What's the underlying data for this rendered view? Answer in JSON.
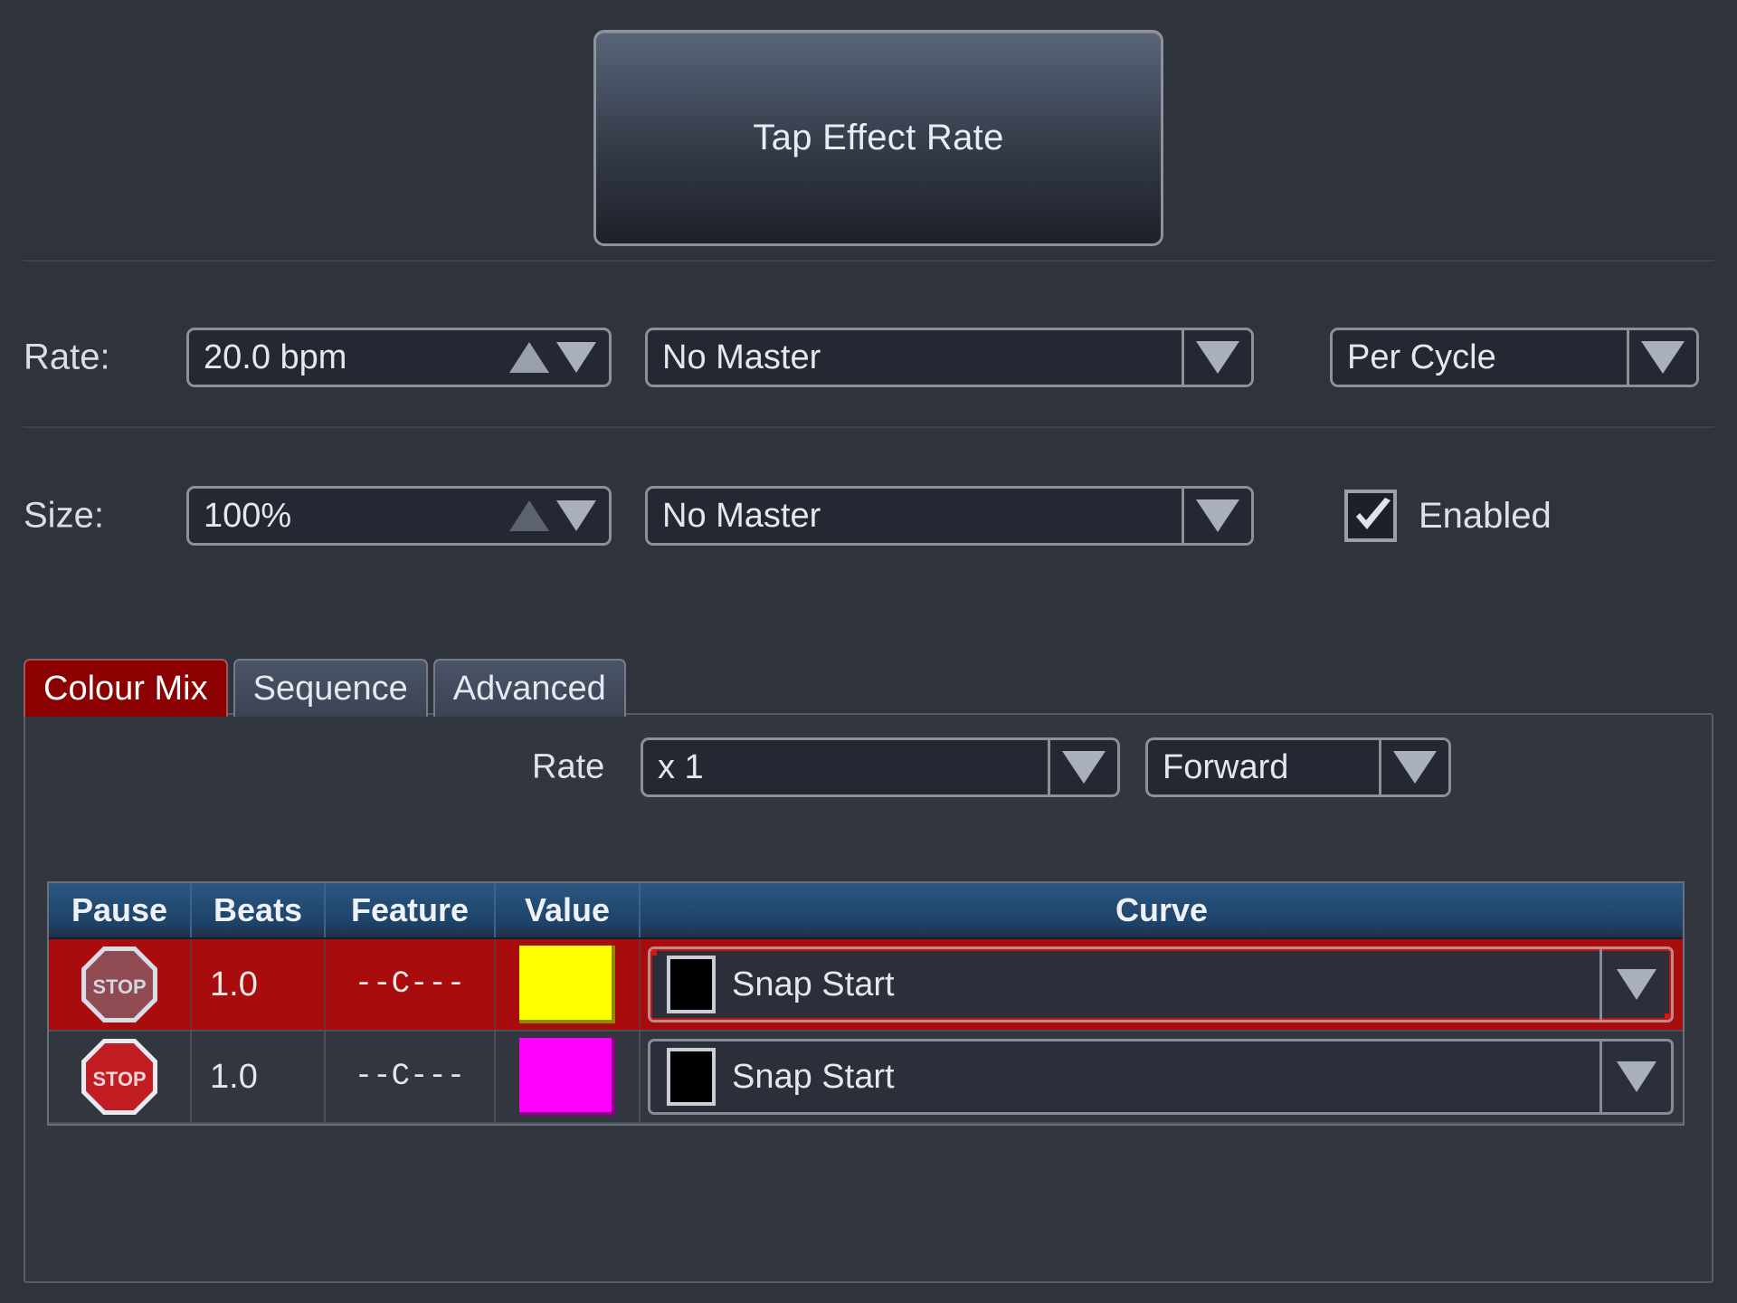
{
  "tap": {
    "label": "Tap Effect Rate"
  },
  "rate_row": {
    "label": "Rate:",
    "value": "20.0 bpm",
    "master": "No Master",
    "mode": "Per Cycle"
  },
  "size_row": {
    "label": "Size:",
    "value": "100%",
    "master": "No Master",
    "enabled_label": "Enabled",
    "enabled_checked": true
  },
  "tabs": [
    {
      "label": "Colour Mix",
      "active": true
    },
    {
      "label": "Sequence",
      "active": false
    },
    {
      "label": "Advanced",
      "active": false
    }
  ],
  "panel": {
    "rate_label": "Rate",
    "rate_multiplier": "x 1",
    "direction": "Forward"
  },
  "table": {
    "headers": [
      "Pause",
      "Beats",
      "Feature",
      "Value",
      "Curve"
    ],
    "rows": [
      {
        "pause_icon": "stop-sign-icon",
        "pause_text": "STOP",
        "beats": "1.0",
        "feature": "--C---",
        "value_color": "#ffff00",
        "curve": "Snap Start",
        "curve_swatch": "#000000",
        "selected": true
      },
      {
        "pause_icon": "stop-sign-icon",
        "pause_text": "STOP",
        "beats": "1.0",
        "feature": "--C---",
        "value_color": "#ff00ff",
        "curve": "Snap Start",
        "curve_swatch": "#000000",
        "selected": false
      }
    ]
  },
  "colors": {
    "background": "#2f333b",
    "accent_red": "#8b0000",
    "selected_row": "#a80c0c",
    "header_blue": "#1d4268",
    "control_border": "#8b9099"
  }
}
